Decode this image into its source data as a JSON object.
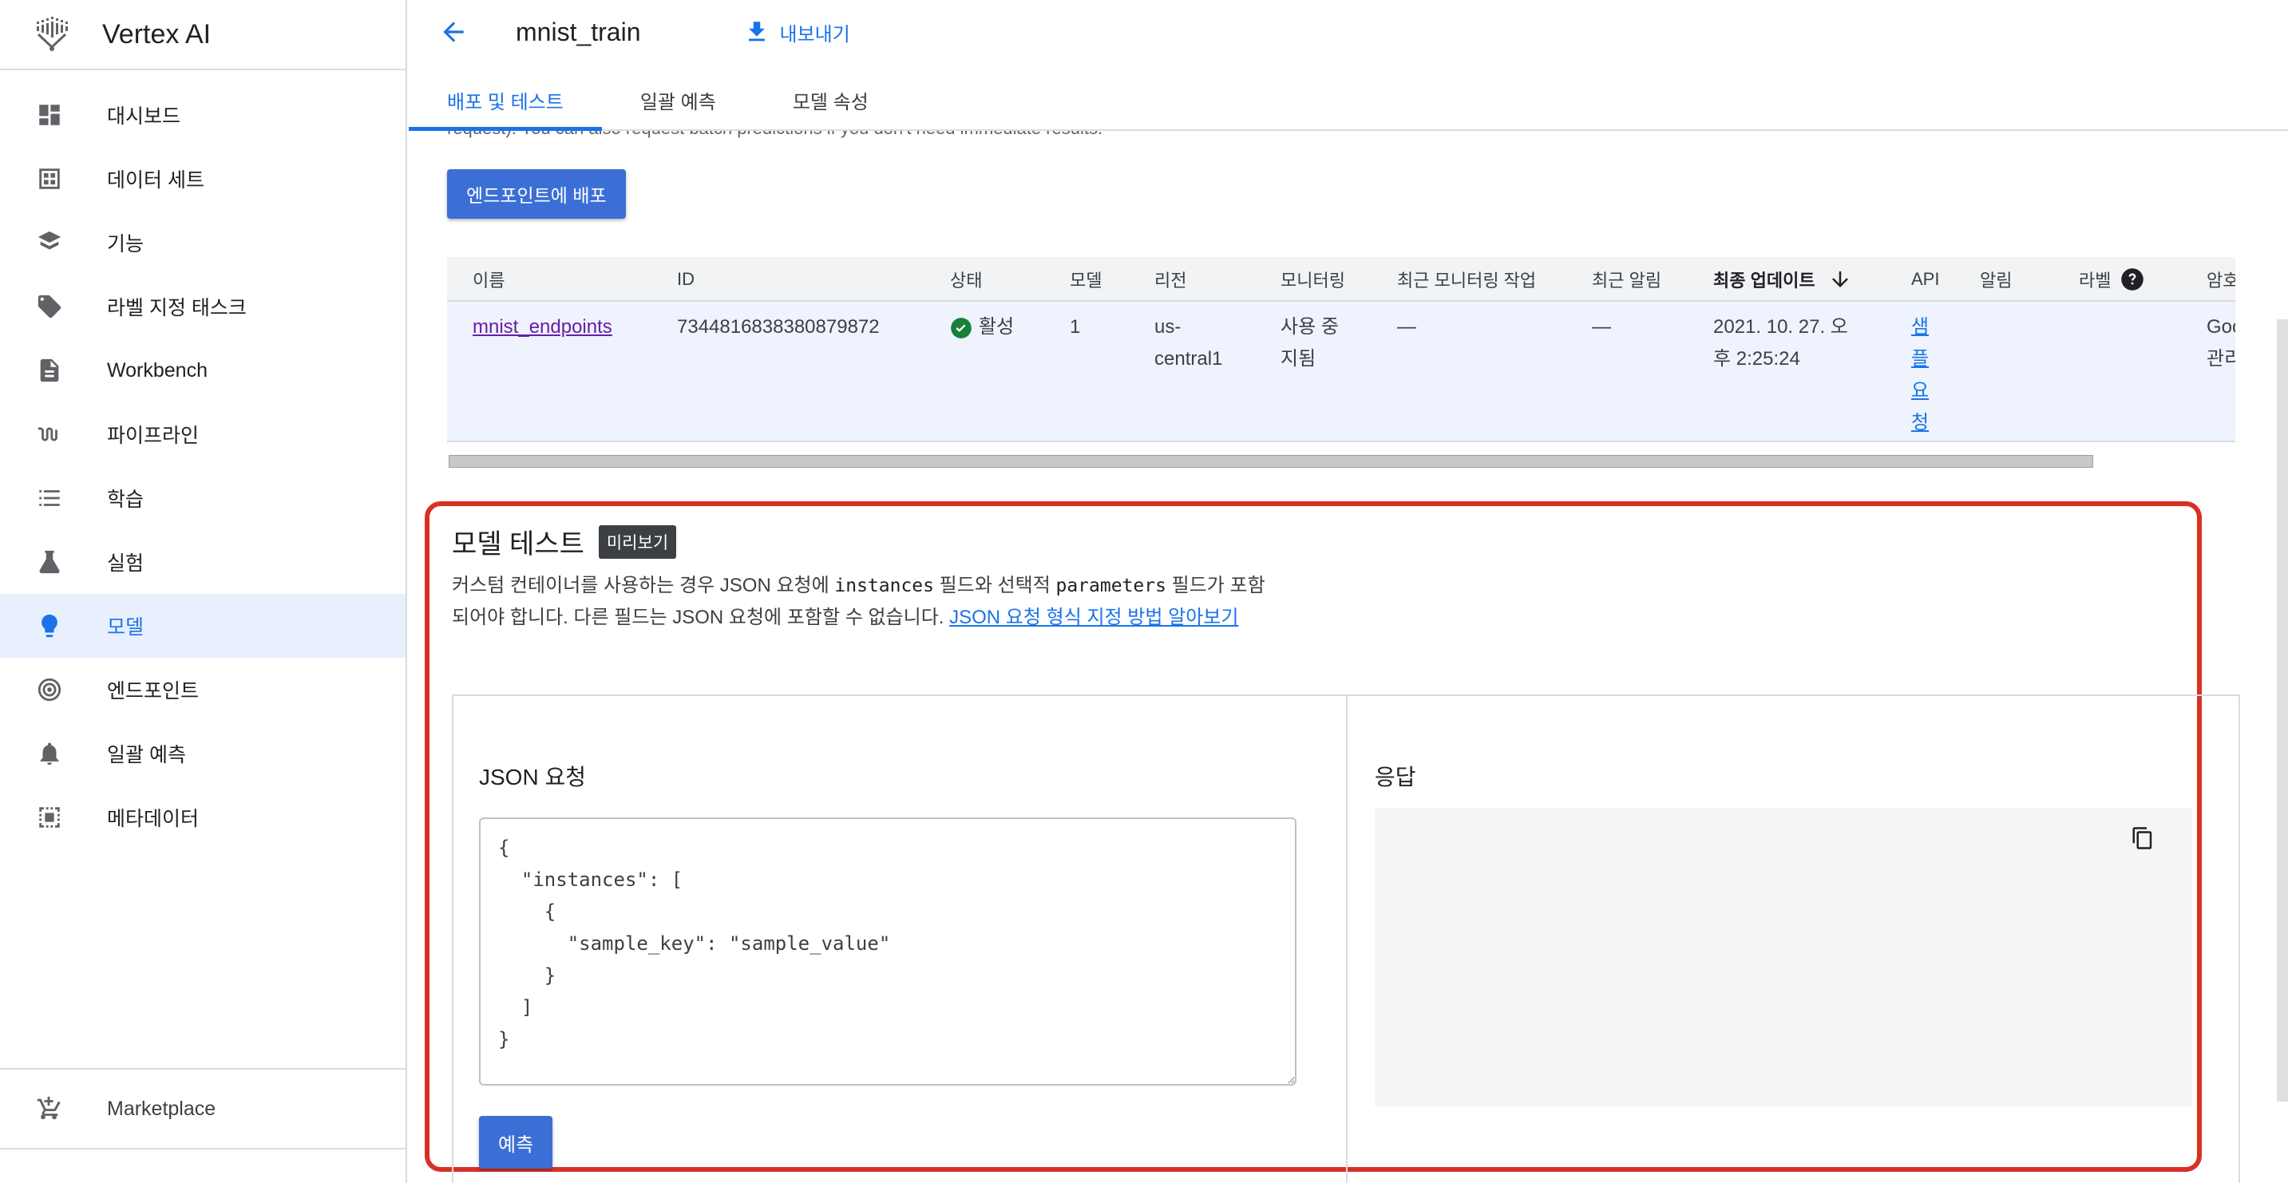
{
  "app": {
    "title": "Vertex AI"
  },
  "sidebar": {
    "items": [
      {
        "label": "대시보드",
        "icon": "dashboard-icon"
      },
      {
        "label": "데이터 세트",
        "icon": "dataset-icon"
      },
      {
        "label": "기능",
        "icon": "feature-layers-icon"
      },
      {
        "label": "라벨 지정 태스크",
        "icon": "label-tag-icon"
      },
      {
        "label": "Workbench",
        "icon": "notebook-icon"
      },
      {
        "label": "파이프라인",
        "icon": "pipeline-icon"
      },
      {
        "label": "학습",
        "icon": "list-icon"
      },
      {
        "label": "실험",
        "icon": "flask-icon"
      },
      {
        "label": "모델",
        "icon": "lightbulb-icon",
        "active": true
      },
      {
        "label": "엔드포인트",
        "icon": "endpoint-icon"
      },
      {
        "label": "일괄 예측",
        "icon": "bell-icon"
      },
      {
        "label": "메타데이터",
        "icon": "metadata-icon"
      }
    ],
    "marketplace": "Marketplace"
  },
  "header": {
    "title": "mnist_train",
    "export_label": "내보내기"
  },
  "tabs": [
    {
      "label": "배포 및 테스트",
      "active": true
    },
    {
      "label": "일괄 예측"
    },
    {
      "label": "모델 속성"
    }
  ],
  "partial_text": "request). You can also request batch predictions if you don't need immediate results.",
  "deploy_button": "엔드포인트에 배포",
  "table": {
    "headers": {
      "name": "이름",
      "id": "ID",
      "status": "상태",
      "model": "모델",
      "region": "리전",
      "monitoring": "모니터링",
      "last_monitoring_job": "최근 모니터링 작업",
      "last_alert": "최근 알림",
      "last_updated": "최종 업데이트",
      "api": "API",
      "alerts": "알림",
      "labels": "라벨",
      "encryption": "암호"
    },
    "row": {
      "name": "mnist_endpoints",
      "id": "7344816838380879872",
      "status": "활성",
      "model": "1",
      "region_line1": "us-",
      "region_line2": "central1",
      "monitoring_line1": "사용 중",
      "monitoring_line2": "지됨",
      "last_monitoring_job": "—",
      "last_alert": "—",
      "last_updated_line1": "2021. 10. 27. 오",
      "last_updated_line2": "후 2:25:24",
      "api_chars": [
        "샘",
        "플",
        "요",
        "청"
      ],
      "encryption_line1": "Goo",
      "encryption_line2": "관리"
    }
  },
  "model_test": {
    "title": "모델 테스트",
    "badge": "미리보기",
    "desc_part1": "커스텀 컨테이너를 사용하는 경우 JSON 요청에 ",
    "desc_code1": "instances",
    "desc_part2": " 필드와 선택적 ",
    "desc_code2": "parameters",
    "desc_part3": " 필드가 포함되어야 합니다. 다른 필드는 JSON 요청에 포함할 수 없습니다. ",
    "desc_link": "JSON 요청 형식 지정 방법 알아보기",
    "json_request_label": "JSON 요청",
    "json_request_value": "{\n  \"instances\": [\n    {\n      \"sample_key\": \"sample_value\"\n    }\n  ]\n}",
    "predict_button": "예측",
    "response_label": "응답"
  },
  "colors": {
    "accent": "#1a73e8",
    "button": "#3b6fd6",
    "highlight_border": "#d93025",
    "active_bg": "#e8f0fe",
    "status_ok": "#188038"
  }
}
